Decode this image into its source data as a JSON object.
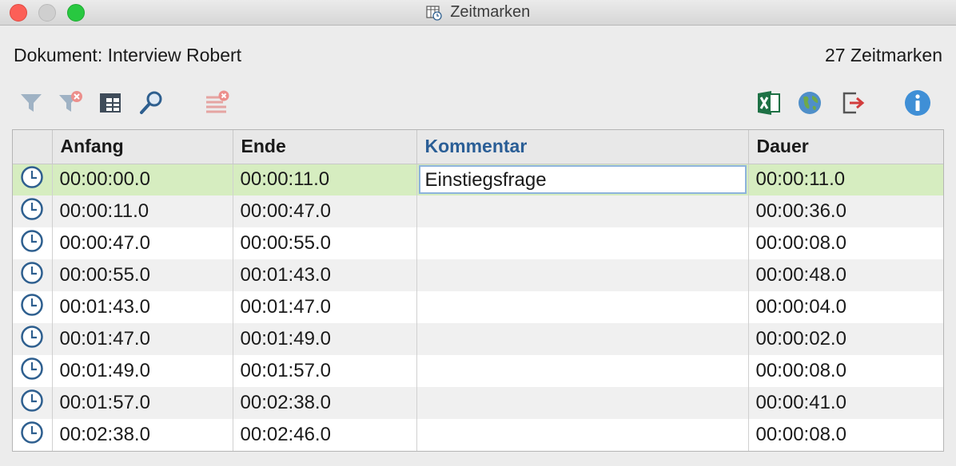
{
  "window": {
    "title": "Zeitmarken"
  },
  "header": {
    "document": "Dokument: Interview Robert",
    "count": "27 Zeitmarken"
  },
  "colors": {
    "selected_row": "#d6edc0",
    "active_header": "#2a5e96"
  },
  "toolbar": {
    "left": [
      "filter-icon",
      "clear-filter-icon",
      "columns-icon",
      "search-icon",
      "delete-list-icon"
    ],
    "right": [
      "excel-export-icon",
      "web-export-icon",
      "export-icon",
      "info-icon"
    ]
  },
  "table": {
    "columns": [
      "Anfang",
      "Ende",
      "Kommentar",
      "Dauer"
    ],
    "rows": [
      {
        "anfang": "00:00:00.0",
        "ende": "00:00:11.0",
        "kommentar": "Einstiegsfrage",
        "dauer": "00:00:11.0"
      },
      {
        "anfang": "00:00:11.0",
        "ende": "00:00:47.0",
        "kommentar": "",
        "dauer": "00:00:36.0"
      },
      {
        "anfang": "00:00:47.0",
        "ende": "00:00:55.0",
        "kommentar": "",
        "dauer": "00:00:08.0"
      },
      {
        "anfang": "00:00:55.0",
        "ende": "00:01:43.0",
        "kommentar": "",
        "dauer": "00:00:48.0"
      },
      {
        "anfang": "00:01:43.0",
        "ende": "00:01:47.0",
        "kommentar": "",
        "dauer": "00:00:04.0"
      },
      {
        "anfang": "00:01:47.0",
        "ende": "00:01:49.0",
        "kommentar": "",
        "dauer": "00:00:02.0"
      },
      {
        "anfang": "00:01:49.0",
        "ende": "00:01:57.0",
        "kommentar": "",
        "dauer": "00:00:08.0"
      },
      {
        "anfang": "00:01:57.0",
        "ende": "00:02:38.0",
        "kommentar": "",
        "dauer": "00:00:41.0"
      },
      {
        "anfang": "00:02:38.0",
        "ende": "00:02:46.0",
        "kommentar": "",
        "dauer": "00:00:08.0"
      }
    ]
  }
}
